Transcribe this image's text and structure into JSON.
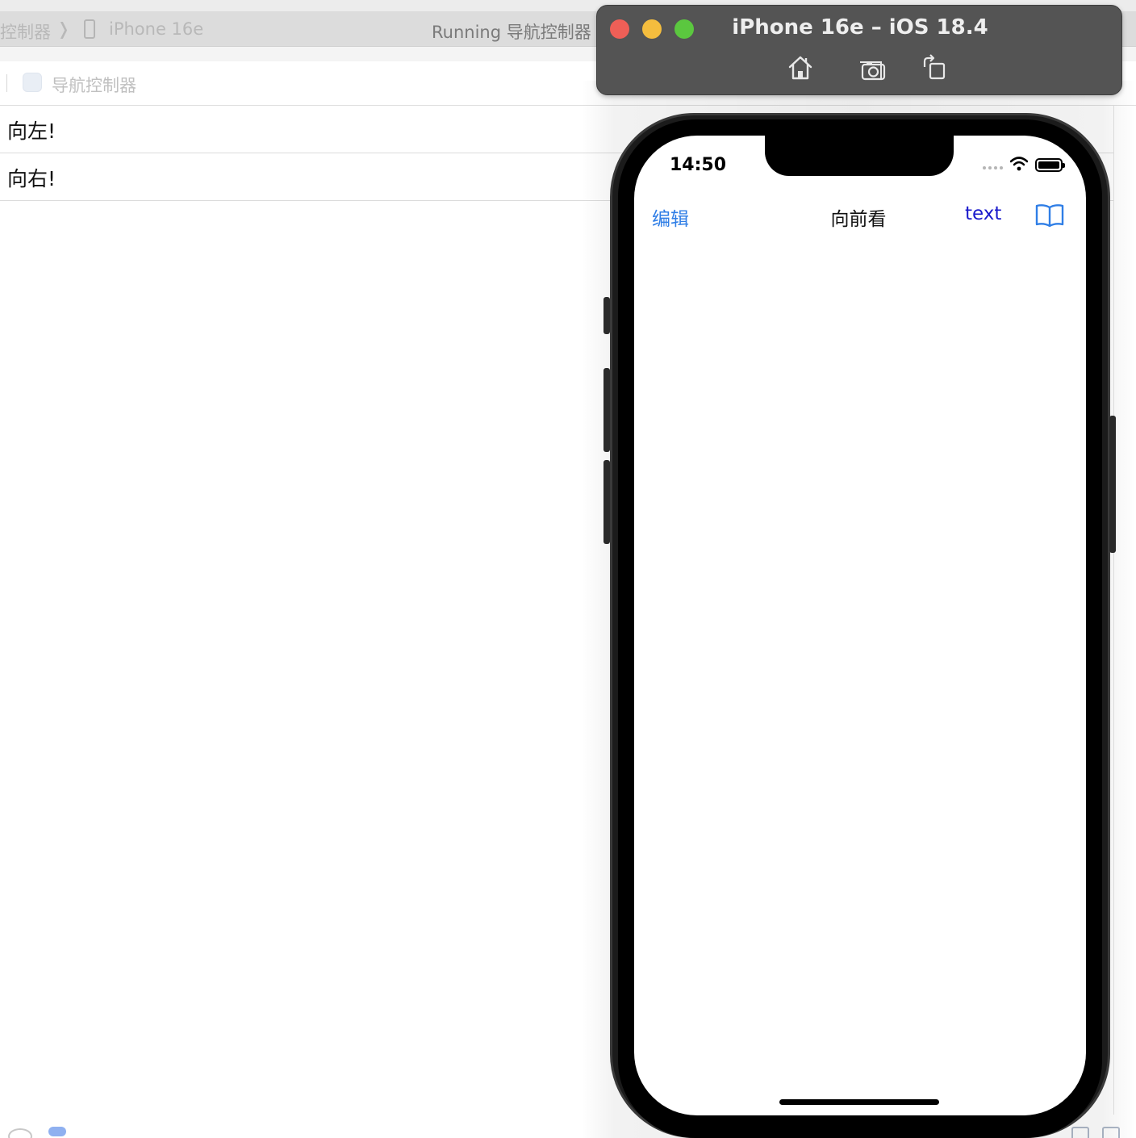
{
  "xcode": {
    "scheme_crumb": "控制器",
    "crumb_separator": "❭",
    "device_name": "iPhone 16e",
    "status": "Running 导航控制器",
    "tab_label": "导航控制器",
    "rows": [
      {
        "label": "向左!"
      },
      {
        "label": "向右!"
      }
    ]
  },
  "simulator": {
    "window_title": "iPhone 16e – iOS 18.4",
    "toolbar": {
      "home_icon": "home-icon",
      "screenshot_icon": "camera-icon",
      "rotate_icon": "rotate-icon"
    },
    "traffic_colors": {
      "close": "#ee5f57",
      "minimize": "#f4bd3e",
      "maximize": "#5bc73f"
    },
    "status_bar": {
      "time": "14:50",
      "signal_icon": "cellular-dots-icon",
      "wifi_icon": "wifi-icon",
      "battery_icon": "battery-icon"
    },
    "nav_bar": {
      "left_button": "编辑",
      "title": "向前看",
      "right_text_button": "text",
      "right_icon": "book-icon"
    },
    "colors": {
      "accent": "#2f7ee6",
      "text_button": "#1a1acc"
    }
  }
}
